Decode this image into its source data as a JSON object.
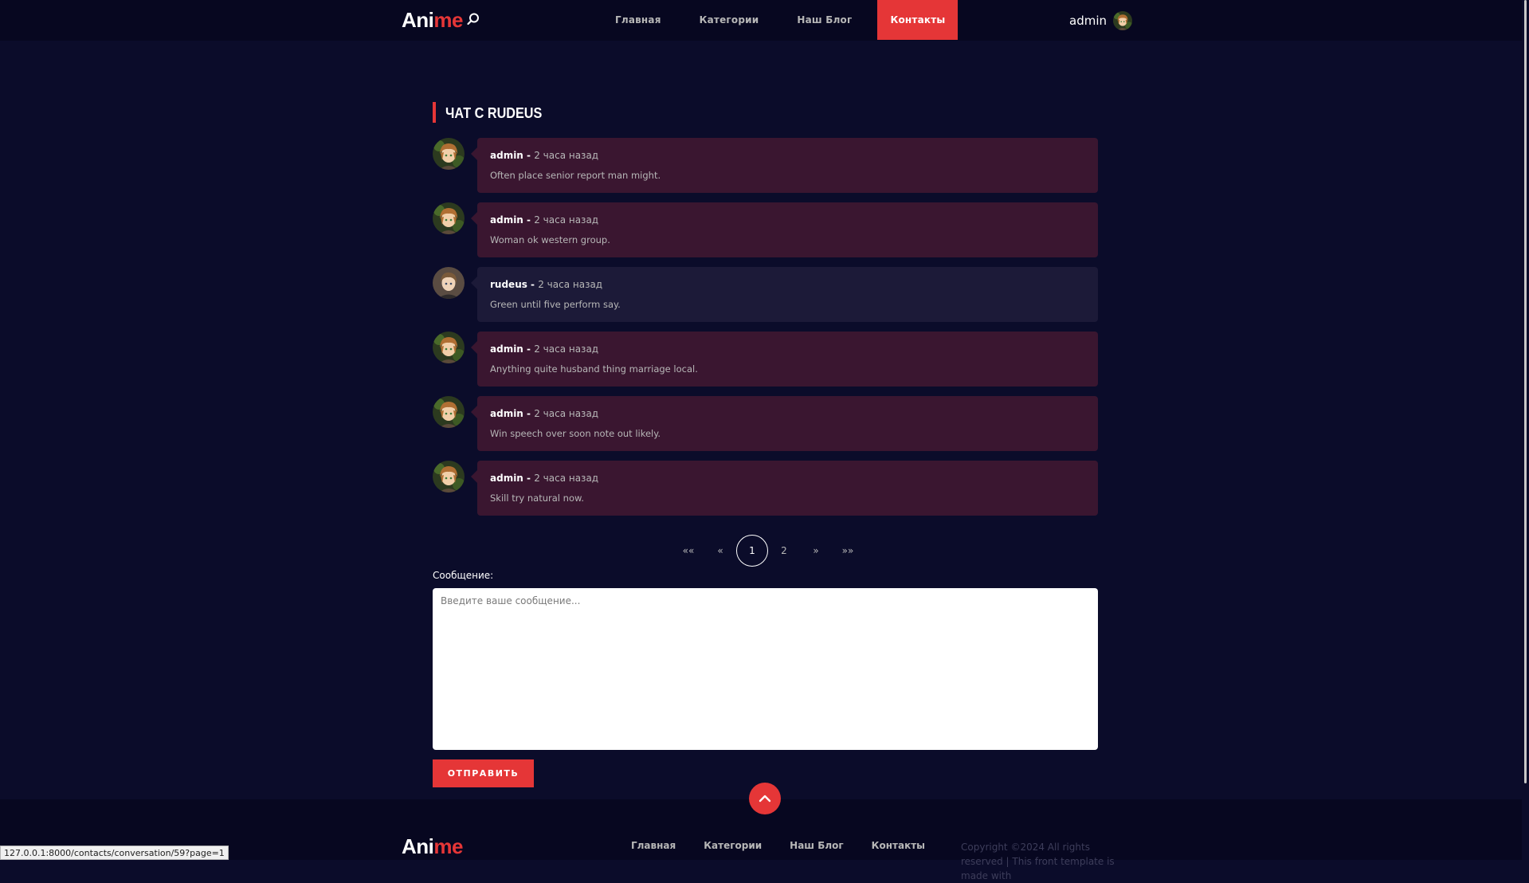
{
  "header": {
    "logo_part1": "Ani",
    "logo_part2": "me",
    "nav": [
      "Главная",
      "Категории",
      "Наш Блог",
      "Контакты"
    ],
    "active_nav": "Контакты",
    "username": "admin"
  },
  "chat": {
    "title": "ЧАТ С RUDEUS",
    "messages": [
      {
        "author": "admin",
        "time": "2 часа назад",
        "text": "Often place senior report man might.",
        "mine": true
      },
      {
        "author": "admin",
        "time": "2 часа назад",
        "text": "Woman ok western group.",
        "mine": true
      },
      {
        "author": "rudeus",
        "time": "2 часа назад",
        "text": "Green until five perform say.",
        "mine": false
      },
      {
        "author": "admin",
        "time": "2 часа назад",
        "text": "Anything quite husband thing marriage local.",
        "mine": true
      },
      {
        "author": "admin",
        "time": "2 часа назад",
        "text": "Win speech over soon note out likely.",
        "mine": true
      },
      {
        "author": "admin",
        "time": "2 часа назад",
        "text": "Skill try natural now.",
        "mine": true
      }
    ],
    "author_separator": " - "
  },
  "pagination": {
    "first": "««",
    "prev": "«",
    "pages": [
      "1",
      "2"
    ],
    "current": "1",
    "next": "»",
    "last": "»»"
  },
  "form": {
    "label": "Сообщение:",
    "placeholder": "Введите ваше сообщение...",
    "value": "",
    "submit_label": "ОТПРАВИТЬ"
  },
  "footer": {
    "logo_part1": "Ani",
    "logo_part2": "me",
    "nav": [
      "Главная",
      "Категории",
      "Наш Блог",
      "Контакты"
    ],
    "copyright": "Copyright ©2024 All rights reserved | This front template is made with"
  },
  "status_url": "127.0.0.1:8000/contacts/conversation/59?page=1",
  "colors": {
    "accent": "#e53637",
    "background": "#0b0c2a",
    "own_bubble": "#3a1630",
    "other_bubble": "#1c1a38"
  }
}
